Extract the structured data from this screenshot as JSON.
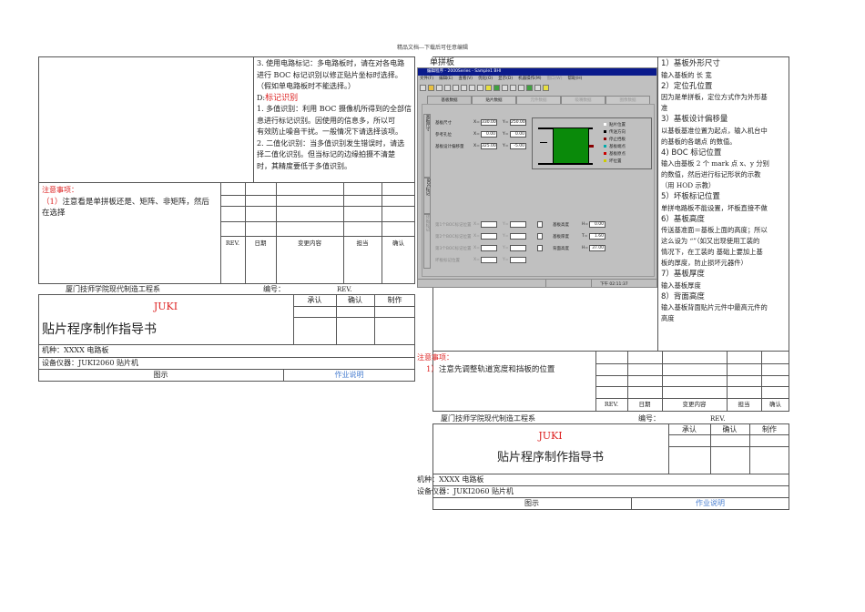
{
  "header": "精品文档---下载后可任意编辑",
  "left": {
    "desc_lines": [
      "3. 使用电路标记：多电路板时，请在对各电路",
      "进行 BOC 标记识别以修正贴片坐标时选择。",
      "（假如单电路板时不能选择。）"
    ],
    "section_prefix": "D:",
    "section_title": "标记识别",
    "section_lines": [
      "1. 多值识别：利用 BOC 摄像机所得到的全部信",
      "息进行标记识别。因使用的信息多，所以可",
      "有效防止噪音干扰。一般情况下请选择该项。",
      "2. 二值化识别：当多值识别发生错误时，请选",
      "择二值化识别。但当标记的边缘拍摄不清楚",
      "时，其精度要低于多值识别。"
    ],
    "notes_title": "注意事项：",
    "notes_num": "（1）",
    "notes_lines": [
      "注意看是单拼板还是、矩阵、非矩阵，然后",
      "在选择"
    ]
  },
  "right": {
    "label": "单拼板",
    "items": [
      {
        "h": "1）基板外形尺寸",
        "b": [
          "输入基板的 长 宽"
        ]
      },
      {
        "h": "2）定位孔位置",
        "b": [
          "因为是单拼板，定位方式作为外形基",
          "准"
        ]
      },
      {
        "h": "3）基板设计偏移量",
        "b": [
          "以基板基准位置为起点，输入机台中",
          "的基板的各端点 的数值。"
        ]
      },
      {
        "h": "4) BOC 标记位置",
        "b": [
          "输入由基板 2 个 mark 点  x、y 分别",
          "的数值，然后进行标记形状的示教",
          "（用 HOD 示教）"
        ]
      },
      {
        "h": "5）坏板标记位置",
        "b": [
          "单拼电路板不能设置，坏板直接不做"
        ]
      },
      {
        "h": "6）基板高度",
        "b": [
          "传送基准面＝基板上面的高度；所以",
          "这么设为 “”（如又出现使用工装的",
          "情况下，在工装的 基础上要加上基",
          "板的厚度，防止损坏元器件）"
        ]
      },
      {
        "h": "7）基板厚度",
        "b": [
          "输入基板厚度"
        ]
      },
      {
        "h": "8）背面高度",
        "b": [
          "输入基板背面贴片元件中最高元件的",
          "高度"
        ]
      }
    ],
    "notes_title": "注意事项：",
    "notes_num": "1）",
    "notes_text": "注意先调整轨道宽度和挡板的位置"
  },
  "app": {
    "title": "编辑程序 - 2000Series - Sample1 BHI",
    "menu": [
      "文件(F)",
      "编辑(E)",
      "查看(V)",
      "优化(O)",
      "显示(D)",
      "机器操作(M)",
      "窗口(W)",
      "帮助(H)"
    ],
    "tabs": [
      "基板数据",
      "贴片数据",
      "元件数据",
      "吸嘴数据",
      "图像数据"
    ],
    "side_tabs": [
      "基板尺寸",
      "BOC标记",
      "坏板标记"
    ],
    "rows": [
      {
        "label": "基板尺寸",
        "x": "330.00",
        "y": "250.00"
      },
      {
        "label": "参考孔位",
        "x": "0.00",
        "y": "0.00"
      },
      {
        "label": "基板设计偏移量",
        "x": "325.00",
        "y": "-5.00"
      }
    ],
    "legend": [
      "贴片位置",
      "传送方向",
      "停止挡板",
      "基板端点",
      "基板原点",
      "坏位置"
    ],
    "boc_rows": [
      "第1个BOC标记位置",
      "第2个BOC标记位置",
      "第3个BOC标记位置",
      "坏板标记位置"
    ],
    "heights": [
      {
        "label": "基板高度",
        "k": "H=",
        "v": "0.00"
      },
      {
        "label": "基板厚度",
        "k": "T=",
        "v": "1.60"
      },
      {
        "label": "背面高度",
        "k": "H=",
        "v": "37.00"
      }
    ],
    "status_time": "下午 02:11:37",
    "x_prefix": "X=",
    "y_prefix": "Y="
  },
  "rev_table": {
    "headers": [
      "REV.",
      "日期",
      "变更内容",
      "担当",
      "确认"
    ]
  },
  "footer": {
    "school": "厦门技师学院现代制造工程系",
    "number_label": "编号：",
    "rev_label": "REV."
  },
  "title_block": {
    "brand": "JUKI",
    "title": "贴片程序制作指导书",
    "approvals": [
      "承认",
      "确认",
      "制作"
    ],
    "model": "机种：XXXX 电路板",
    "equipment": "设备仪器：JUKI2060 贴片机",
    "figure": "图示",
    "instructions": "作业说明"
  },
  "colors": {
    "red": "#dd2222",
    "blue": "#4a7fd0",
    "green": "#0a8a0a"
  }
}
